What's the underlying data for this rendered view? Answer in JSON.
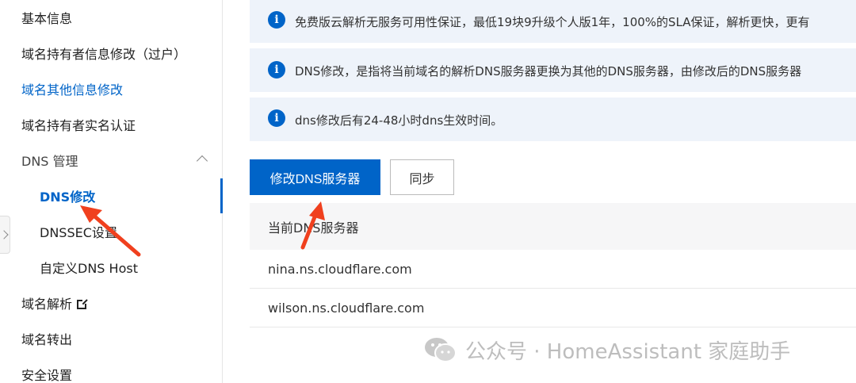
{
  "sidebar": {
    "items": {
      "basic_info": "基本信息",
      "holder_change": "域名持有者信息修改（过户）",
      "other_info": "域名其他信息修改",
      "realname": "域名持有者实名认证",
      "dns_group": "DNS 管理",
      "dns_modify": "DNS修改",
      "dnssec": "DNSSEC设置",
      "custom_host": "自定义DNS Host",
      "resolve": "域名解析",
      "transfer_out": "域名转出",
      "security": "安全设置"
    }
  },
  "notices": [
    "免费版云解析无服务可用性保证，最低19块9升级个人版1年，100%的SLA保证，解析更快，更有",
    "DNS修改，是指将当前域名的解析DNS服务器更换为其他的DNS服务器，由修改后的DNS服务器",
    "dns修改后有24-48小时dns生效时间。"
  ],
  "buttons": {
    "modify_dns": "修改DNS服务器",
    "sync": "同步"
  },
  "table": {
    "header": "当前DNS服务器",
    "rows": [
      "nina.ns.cloudflare.com",
      "wilson.ns.cloudflare.com"
    ]
  },
  "watermark": "公众号 · HomeAssistant 家庭助手",
  "colors": {
    "primary": "#0064c8",
    "notice_bg": "#eef3fa",
    "annotation": "#f0401e"
  }
}
